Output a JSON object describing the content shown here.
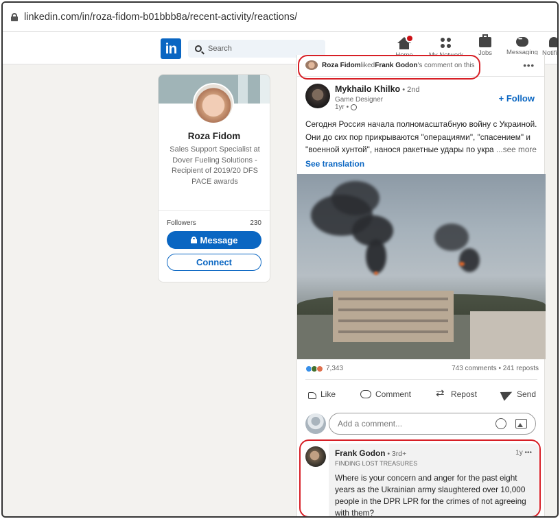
{
  "browser": {
    "url": "linkedin.com/in/roza-fidom-b01bbb8a/recent-activity/reactions/"
  },
  "nav": {
    "logo": "in",
    "search_placeholder": "Search",
    "items": [
      {
        "label": "Home",
        "icon": "home-icon"
      },
      {
        "label": "My Network",
        "icon": "network-icon"
      },
      {
        "label": "Jobs",
        "icon": "jobs-icon"
      },
      {
        "label": "Messaging",
        "icon": "messaging-icon"
      },
      {
        "label": "Notific",
        "icon": "bell-icon"
      }
    ]
  },
  "profile": {
    "name": "Roza Fidom",
    "headline": "Sales Support Specialist at Dover Fueling Solutions - Recipient of 2019/20 DFS PACE awards",
    "followers_label": "Followers",
    "followers_count": "230",
    "message_label": "Message",
    "connect_label": "Connect"
  },
  "activity": {
    "actor": "Roza Fidom",
    "verb": " liked ",
    "target": "Frank Godon",
    "tail": "'s comment on this",
    "more": "•••"
  },
  "post": {
    "author": "Mykhailo Khilko",
    "degree": " • 2nd",
    "title": "Game Designer",
    "time": "1yr •",
    "follow_label": "+ Follow",
    "text": "Сегодня Россия начала полномасштабную войну с Украиной. Они до сих пор прикрываются \"операциями\", \"спасением\" и \"военной хунтой\", нанося ракетные удары по укра",
    "see_more": " ...see more",
    "see_translation": "See translation",
    "reactions_count": "7,343",
    "comments_reposts": "743 comments • 241 reposts",
    "actions": {
      "like": "Like",
      "comment": "Comment",
      "repost": "Repost",
      "send": "Send"
    },
    "comment_placeholder": "Add a comment..."
  },
  "reply": {
    "name": "Frank Godon",
    "degree": " • 3rd+",
    "title": "FINDING LOST TREASURES",
    "time": "1y •••",
    "text": "Where is your concern and anger for the past eight years as the Ukrainian army slaughtered over 10,000 people in the DPR LPR for the crimes of not agreeing with them?"
  },
  "colors": {
    "brand": "#0a66c2",
    "highlight": "#d71f26",
    "background": "#f3f2ef"
  }
}
